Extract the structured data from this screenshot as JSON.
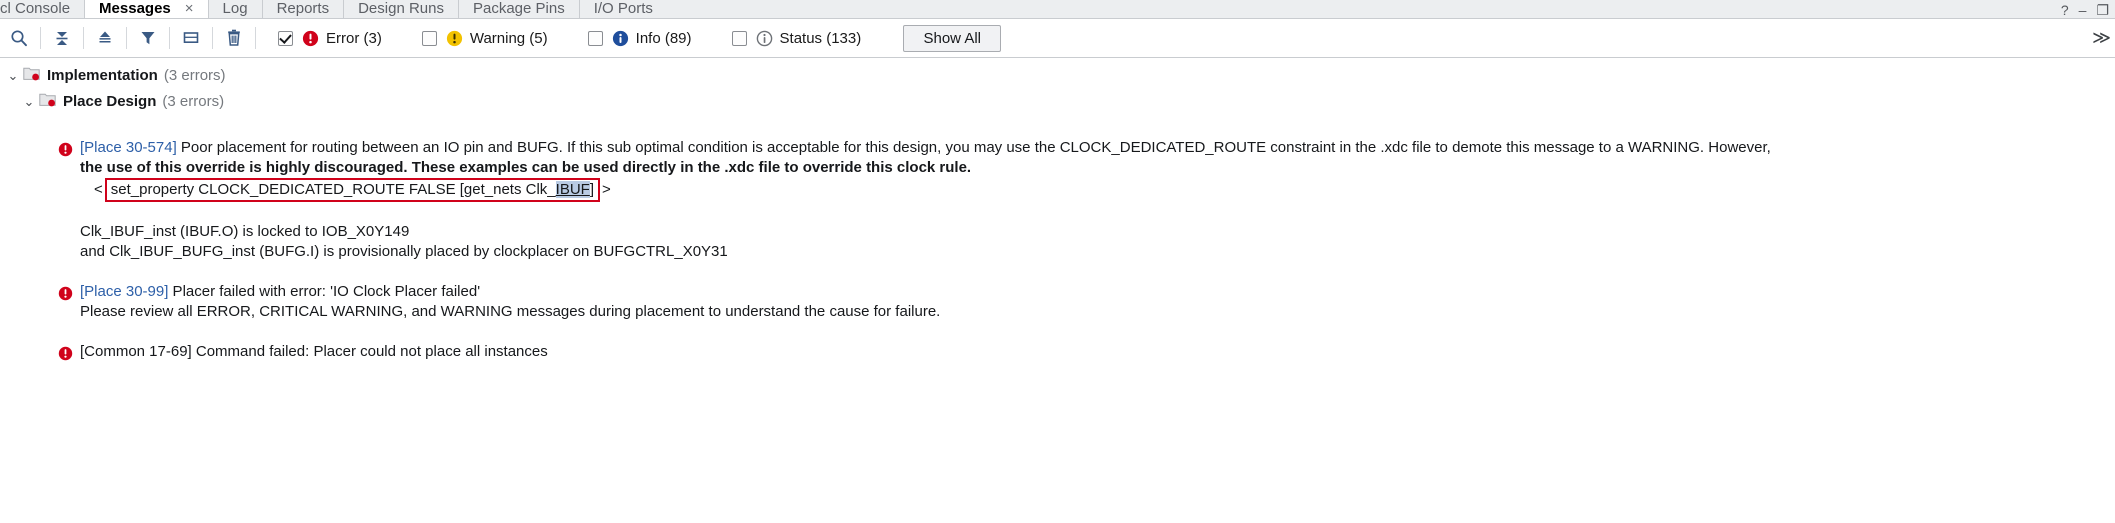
{
  "window": {
    "tabs": [
      {
        "label": "cl Console",
        "active": false,
        "closable": false
      },
      {
        "label": "Messages",
        "active": true,
        "closable": true
      },
      {
        "label": "Log",
        "active": false,
        "closable": false
      },
      {
        "label": "Reports",
        "active": false,
        "closable": false
      },
      {
        "label": "Design Runs",
        "active": false,
        "closable": false
      },
      {
        "label": "Package Pins",
        "active": false,
        "closable": false
      },
      {
        "label": "I/O Ports",
        "active": false,
        "closable": false
      }
    ],
    "close_glyph": "×",
    "help_glyph": "?",
    "minimize_glyph": "–",
    "maximize_glyph": "❐"
  },
  "toolbar": {
    "icons": [
      {
        "name": "search-icon",
        "title": "Search"
      },
      {
        "name": "collapse-all-icon",
        "title": "Collapse All"
      },
      {
        "name": "expand-all-icon",
        "title": "Expand All"
      },
      {
        "name": "filter-icon",
        "title": "Filter"
      },
      {
        "name": "message-icon",
        "title": "Show Message Details"
      },
      {
        "name": "trash-icon",
        "title": "Clear Messages"
      }
    ],
    "filters": [
      {
        "id": "error",
        "label": "Error (3)",
        "checked": true,
        "icon": "error-icon",
        "color": "#d0021b"
      },
      {
        "id": "warning",
        "label": "Warning (5)",
        "checked": false,
        "icon": "warning-icon",
        "color": "#f2c200"
      },
      {
        "id": "info",
        "label": "Info (89)",
        "checked": false,
        "icon": "info-icon",
        "color": "#1f4e9c"
      },
      {
        "id": "status",
        "label": "Status (133)",
        "checked": false,
        "icon": "status-icon",
        "color": "#6e7277"
      }
    ],
    "show_all_label": "Show All",
    "overflow_glyph": "≫"
  },
  "tree": {
    "implementation": {
      "label": "Implementation",
      "count": "(3 errors)",
      "twisty": "⌄",
      "icon": "folder-error-icon"
    },
    "place_design": {
      "label": "Place Design",
      "count": "(3 errors)",
      "twisty": "⌄",
      "icon": "folder-error-icon"
    },
    "messages": [
      {
        "severity": "error",
        "code": "[Place 30-574]",
        "line1_rest": " Poor placement for routing between an IO pin and BUFG. If this sub optimal condition is acceptable for this design, you may use the CLOCK_DEDICATED_ROUTE constraint in the .xdc file to demote this message to a WARNING. However,",
        "line2_bold": "the use of this override is highly discouraged. These examples can be used directly in the .xdc file to override this clock rule.",
        "command": {
          "prefix_angle": "<",
          "text_plain": "set_property CLOCK_DEDICATED_ROUTE FALSE [get_nets Clk_",
          "text_selected": "IBUF",
          "text_tail": "]",
          "suffix_angle": ">",
          "box_color": "#d0021b"
        },
        "detail_lines": [
          "Clk_IBUF_inst (IBUF.O) is locked to IOB_X0Y149",
          "and Clk_IBUF_BUFG_inst (BUFG.I) is provisionally placed by clockplacer on BUFGCTRL_X0Y31"
        ]
      },
      {
        "severity": "error",
        "code": "[Place 30-99]",
        "line1_rest": " Placer failed with error: 'IO Clock Placer failed'",
        "line2_plain": "Please review all ERROR, CRITICAL WARNING, and WARNING messages during placement to understand the cause for failure."
      },
      {
        "severity": "error",
        "code": "[Common 17-69]",
        "code_plain": true,
        "line1_rest": " Command failed: Placer could not place all instances"
      }
    ]
  }
}
